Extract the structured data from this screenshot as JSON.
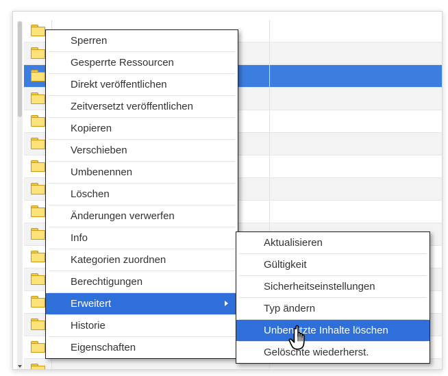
{
  "context_menu": {
    "items": [
      {
        "label": "Sperren"
      },
      {
        "label": "Gesperrte Ressourcen"
      },
      {
        "label": "Direkt veröffentlichen"
      },
      {
        "label": "Zeitversetzt veröffentlichen"
      },
      {
        "label": "Kopieren"
      },
      {
        "label": "Verschieben"
      },
      {
        "label": "Umbenennen"
      },
      {
        "label": "Löschen"
      },
      {
        "label": "Änderungen verwerfen"
      },
      {
        "label": "Info"
      },
      {
        "label": "Kategorien zuordnen"
      },
      {
        "label": "Berechtigungen"
      },
      {
        "label": "Erweitert",
        "highlighted": true
      },
      {
        "label": "Historie"
      },
      {
        "label": "Eigenschaften"
      }
    ]
  },
  "submenu": {
    "items": [
      {
        "label": "Aktualisieren"
      },
      {
        "label": "Gültigkeit"
      },
      {
        "label": "Sicherheitseinstellungen"
      },
      {
        "label": "Typ ändern"
      },
      {
        "label": "Unbenutzte Inhalte löschen",
        "highlighted": true
      },
      {
        "label": "Gelöschte wiederherst."
      }
    ]
  },
  "file_list": {
    "selected_row": 2,
    "row_count": 16
  },
  "colors": {
    "selection": "#3c7ee0",
    "menu_highlight": "#2f6fd9",
    "folder": "#fde27a"
  },
  "icons": [
    "folder-icon",
    "submenu-arrow-icon",
    "hand-cursor-icon"
  ]
}
